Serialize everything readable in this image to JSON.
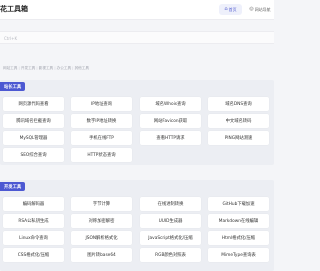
{
  "header": {
    "brand": "花工具箱",
    "nav_home": "首页",
    "nav_sites": "网站导航"
  },
  "search": {
    "placeholder": "Ctrl+K"
  },
  "breadcrumbs": [
    "网站工具",
    "开发工具",
    "影视工具",
    "办公工具",
    "其他工具"
  ],
  "sections": [
    {
      "title": "站长工具",
      "items": [
        "网页源代码查看",
        "IP地址查询",
        "域名Whois查询",
        "域名DNS查询",
        "腾讯域名拦截查询",
        "数字IP地址转换",
        "网站Favicon获取",
        "中文域名转码",
        "MySQL管理器",
        "手机在线FTP",
        "查看HTTP请求",
        "PING网站测速",
        "SEO综合查询",
        "HTTP状态查询"
      ]
    },
    {
      "title": "开发工具",
      "items": [
        "编码解码器",
        "字节计算",
        "在线进制转换",
        "GitHub下载加速",
        "RSA公私钥生成",
        "对称加密解密",
        "UUID生成器",
        "Markdown在线编辑",
        "Linux命令查询",
        "JSON解析格式化",
        "JavaScript格式化/压缩",
        "Html格式化/压缩",
        "CSS格式化/压缩",
        "图片转base64",
        "RGB颜色对照表",
        "MimeType查询表"
      ]
    }
  ],
  "colors": {
    "accent": "#4c58d2",
    "page_bg": "#f4f5f8",
    "card_bg": "#ffffff"
  },
  "icons": {
    "home": "home-icon",
    "nav": "compass-icon"
  }
}
